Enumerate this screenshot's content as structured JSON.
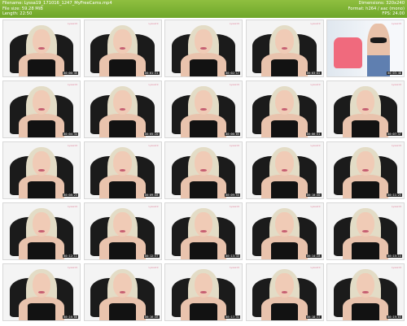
{
  "header": {
    "filename": "Filename: Lyssa19_171016_1247_MyFreeCams.mp4",
    "filesize": "File size: 59.28 MiB",
    "length": "Length: 22:50",
    "dimensions": "Dimensions: 320x240",
    "format": "Format: h264 / aac (mono)",
    "fps": "FPS: 24.00"
  },
  "colors": {
    "header_bar": "#7ab234",
    "background": "#ffffff"
  },
  "frames": [
    {
      "time": "00:00:45",
      "kind": "face"
    },
    {
      "time": "00:01:31",
      "kind": "face"
    },
    {
      "time": "00:02:17",
      "kind": "face"
    },
    {
      "time": "00:03:02",
      "kind": "face"
    },
    {
      "time": "00:03:48",
      "kind": "room"
    },
    {
      "time": "00:04:34",
      "kind": "face"
    },
    {
      "time": "00:05:20",
      "kind": "face"
    },
    {
      "time": "00:06:05",
      "kind": "face"
    },
    {
      "time": "00:06:51",
      "kind": "face"
    },
    {
      "time": "00:07:37",
      "kind": "face"
    },
    {
      "time": "00:08:23",
      "kind": "face"
    },
    {
      "time": "00:09:08",
      "kind": "face"
    },
    {
      "time": "00:09:54",
      "kind": "face"
    },
    {
      "time": "00:10:40",
      "kind": "face"
    },
    {
      "time": "00:11:25",
      "kind": "face"
    },
    {
      "time": "00:12:11",
      "kind": "face"
    },
    {
      "time": "00:12:57",
      "kind": "face"
    },
    {
      "time": "00:13:43",
      "kind": "face"
    },
    {
      "time": "00:14:28",
      "kind": "face"
    },
    {
      "time": "00:15:14",
      "kind": "face"
    },
    {
      "time": "00:16:00",
      "kind": "face"
    },
    {
      "time": "00:16:46",
      "kind": "face"
    },
    {
      "time": "00:17:31",
      "kind": "face"
    },
    {
      "time": "00:18:17",
      "kind": "face"
    },
    {
      "time": "00:19:03",
      "kind": "face"
    }
  ],
  "watermark": "Lyssa19"
}
